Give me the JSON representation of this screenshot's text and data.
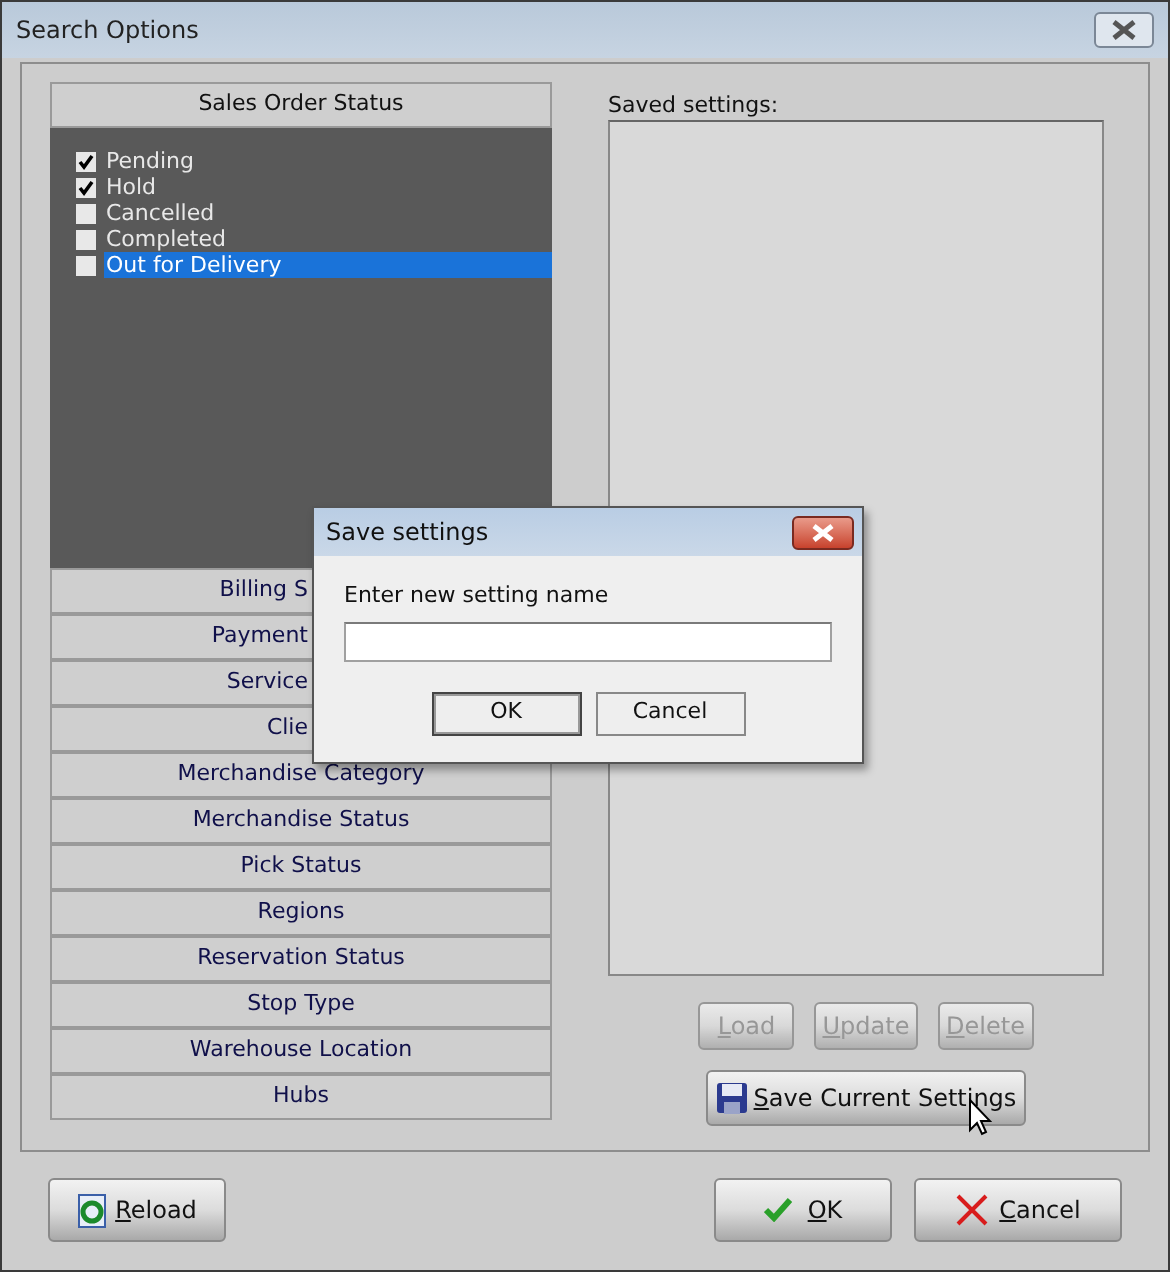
{
  "window": {
    "title": "Search Options"
  },
  "accordion": {
    "open_section": {
      "title": "Sales Order Status",
      "items": [
        {
          "label": "Pending",
          "checked": true,
          "selected": false
        },
        {
          "label": "Hold",
          "checked": true,
          "selected": false
        },
        {
          "label": "Cancelled",
          "checked": false,
          "selected": false
        },
        {
          "label": "Completed",
          "checked": false,
          "selected": false
        },
        {
          "label": "Out for Delivery",
          "checked": false,
          "selected": true
        }
      ]
    },
    "sections": [
      {
        "title": "Billing S",
        "kind": "covered"
      },
      {
        "title": "Payment",
        "kind": "covered"
      },
      {
        "title": "Service",
        "kind": "covered"
      },
      {
        "title": "Clie",
        "kind": "covered"
      },
      {
        "title": "Merchandise Category",
        "kind": "full"
      },
      {
        "title": "Merchandise Status",
        "kind": "full"
      },
      {
        "title": "Pick Status",
        "kind": "full"
      },
      {
        "title": "Regions",
        "kind": "full"
      },
      {
        "title": "Reservation Status",
        "kind": "full"
      },
      {
        "title": "Stop Type",
        "kind": "full"
      },
      {
        "title": "Warehouse Location",
        "kind": "full"
      },
      {
        "title": "Hubs",
        "kind": "full"
      }
    ]
  },
  "saved_settings": {
    "label": "Saved settings:",
    "buttons": [
      {
        "label": "Load",
        "disabled": true
      },
      {
        "label": "Update",
        "disabled": true
      },
      {
        "label": "Delete",
        "disabled": true
      }
    ],
    "save_button": "Save Current Settings"
  },
  "footer": {
    "reload": "Reload",
    "ok": "OK",
    "cancel": "Cancel"
  },
  "dialog": {
    "title": "Save settings",
    "prompt": "Enter new setting name",
    "buttons": [
      "OK",
      "Cancel"
    ]
  }
}
